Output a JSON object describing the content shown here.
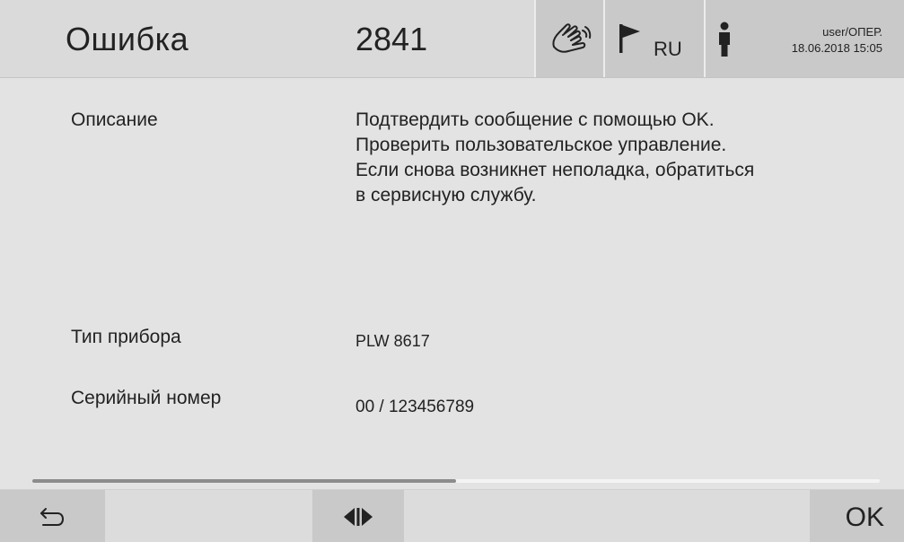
{
  "header": {
    "title": "Ошибка",
    "error_code": "2841",
    "touch_icon": "touch-hand-icon",
    "flag_icon": "flag-icon",
    "language": "RU",
    "person_icon": "person-icon",
    "user": "user/ОПЕР.",
    "datetime": "18.06.2018 15:05"
  },
  "content": {
    "description_label": "Описание",
    "description_lines": [
      "Подтвердить сообщение с помощью OK.",
      "Проверить пользовательское управление.",
      "Если снова возникнет неполадка, обратиться",
      "в сервисную службу."
    ],
    "device_type_label": "Тип прибора",
    "device_type_value": "PLW 8617",
    "serial_label": "Серийный номер",
    "serial_value": "00 / 123456789"
  },
  "progress": {
    "fraction": 0.5
  },
  "footer": {
    "back_icon": "back-arrow-icon",
    "nav_icon": "scroll-left-right-icon",
    "ok_label": "OK"
  },
  "colors": {
    "background": "#e3e3e3",
    "button": "#c9c9c9",
    "progress_track": "#f4f4f4",
    "progress_fill": "#8c8c8c",
    "text": "#222222"
  }
}
